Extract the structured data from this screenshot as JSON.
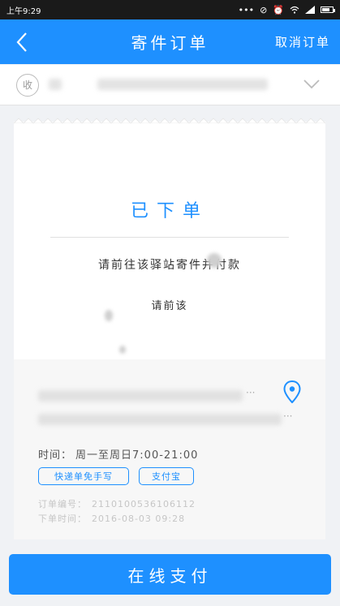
{
  "status_bar": {
    "time": "上午9:29",
    "icons": [
      "dots-icon",
      "mute-icon",
      "alarm-icon",
      "wifi-icon",
      "signal-icon",
      "battery-icon"
    ]
  },
  "header": {
    "title": "寄件订单",
    "cancel_label": "取消订单",
    "back_icon": "back-arrow-icon",
    "background": "#1e90ff"
  },
  "receiver": {
    "badge": "收",
    "expand_icon": "chevron-down-icon"
  },
  "order": {
    "status": "已下单",
    "instruction": "请前往该驿站寄件并付款",
    "sub_instruction": "请前该",
    "accent_color": "#1e90ff"
  },
  "station": {
    "name_more": "···",
    "address_more": "···",
    "location_icon": "location-pin-icon",
    "hours_label": "时间：",
    "hours_value": "周一至周日7:00-21:00",
    "tags": [
      "快递单免手写",
      "支付宝"
    ],
    "order_number_label": "订单编号：",
    "order_number": "2110100536106112",
    "order_time_label": "下单时间：",
    "order_time": "2016-08-03 09:28"
  },
  "footer": {
    "pay_button": "在线支付"
  }
}
